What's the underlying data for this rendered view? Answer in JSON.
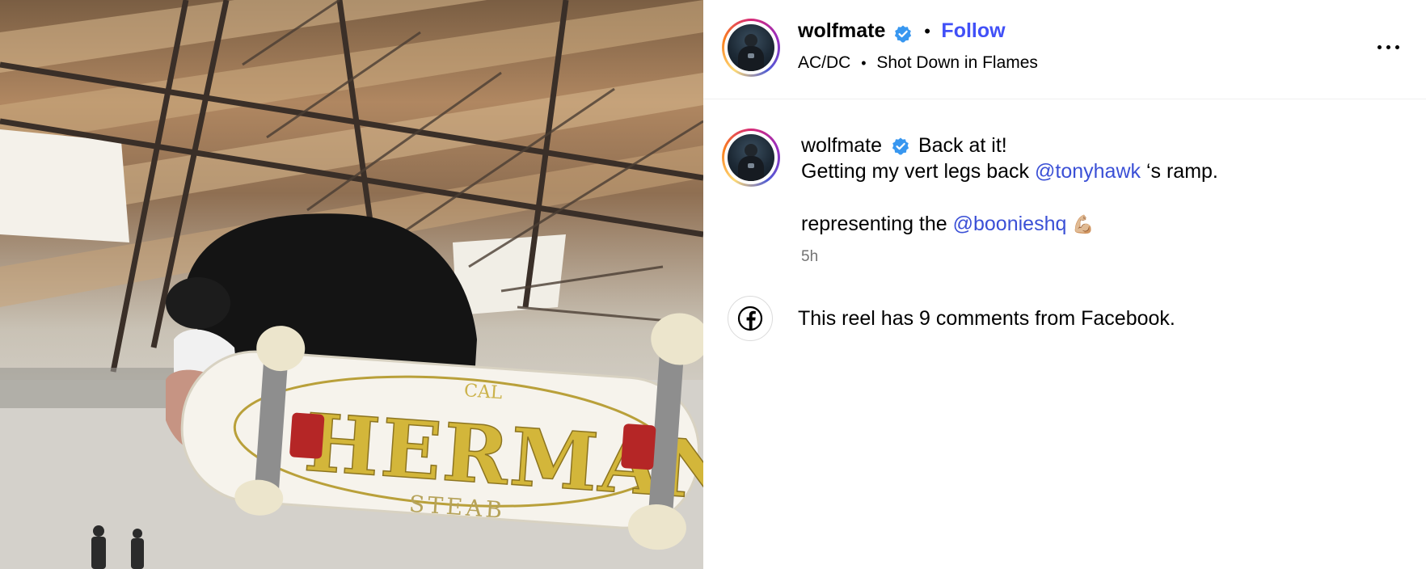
{
  "post": {
    "author": "wolfmate",
    "follow_label": "Follow",
    "separator": "•",
    "audio_artist": "AC/DC",
    "audio_title": "Shot Down in Flames"
  },
  "caption": {
    "author": "wolfmate",
    "line1_text": "Back at it!",
    "line2_prefix": "Getting my vert legs back ",
    "line2_mention": "@tonyhawk",
    "line2_suffix": " ‘s ramp.",
    "line3_prefix": "representing the ",
    "line3_mention": "@boonieshq",
    "emoji": "💪🏼",
    "timestamp": "5h"
  },
  "comments_notice": {
    "text": "This reel has 9 comments from Facebook."
  },
  "media": {
    "board_graphic_text": "HERMANN",
    "board_sub_text": "STEAB",
    "board_top_text": "CAL"
  },
  "colors": {
    "follow": "#4150f7",
    "mention": "#3b50d6",
    "verified": "#3897f0",
    "timestamp": "#737373"
  },
  "icons": {
    "verified": "verified-badge-icon",
    "more": "more-options-icon",
    "facebook": "facebook-icon"
  }
}
